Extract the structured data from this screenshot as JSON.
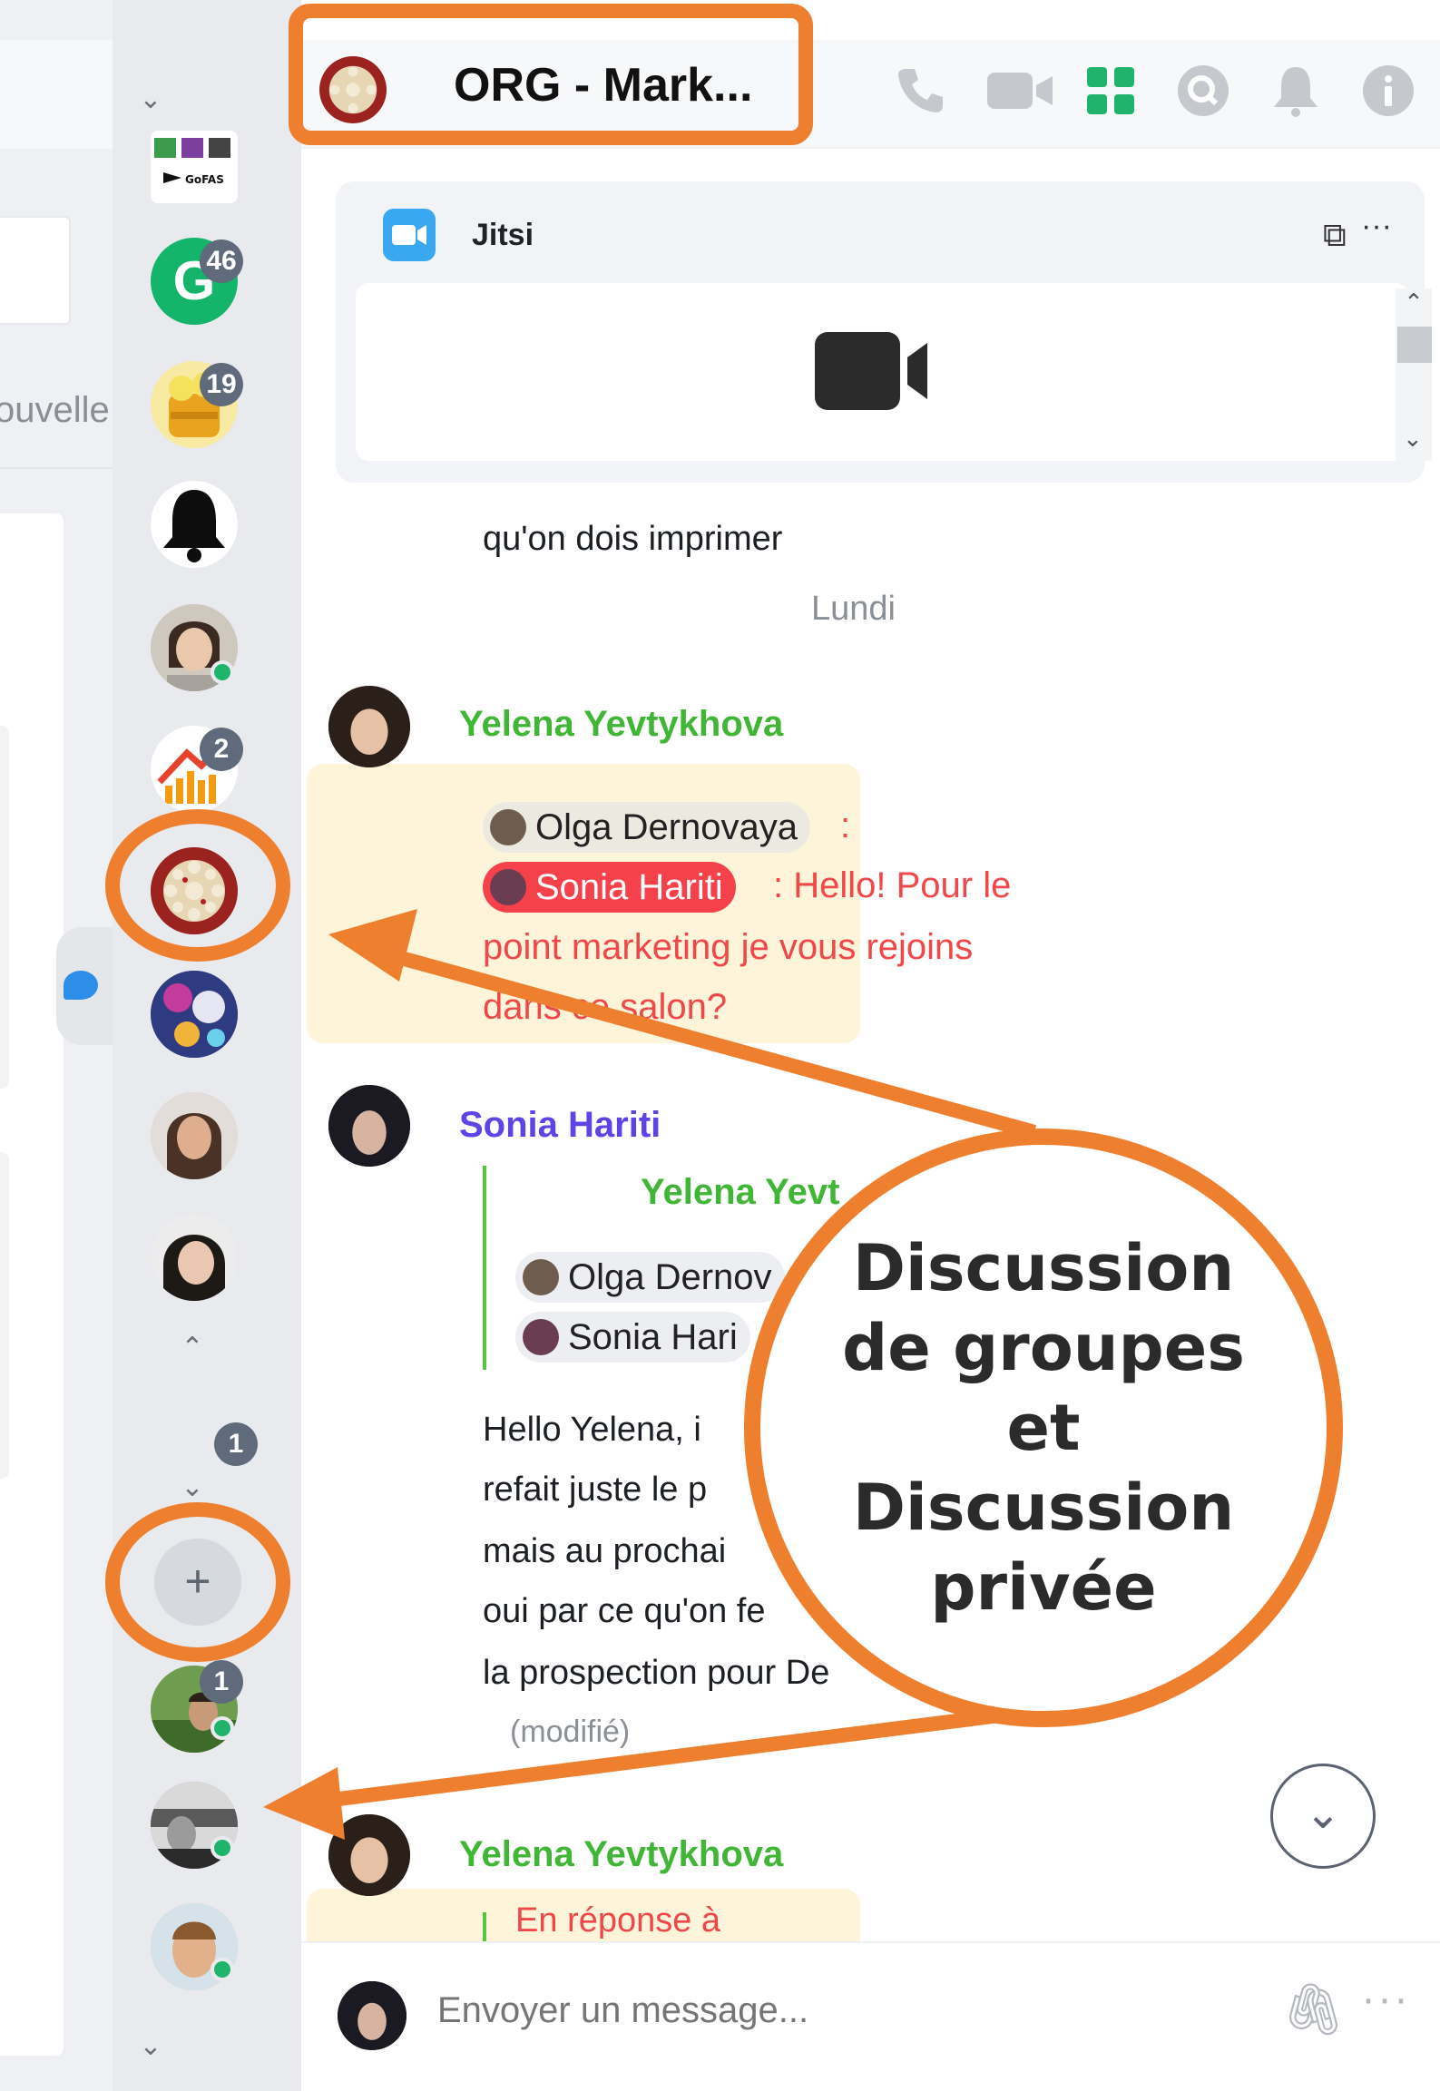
{
  "left_pane": {
    "partial_text": "ouvelle"
  },
  "header": {
    "title": "ORG - Mark..."
  },
  "jitsi": {
    "name": "Jitsi"
  },
  "messages": {
    "prev_line": "qu'on dois imprimer",
    "day_separator": "Lundi",
    "m1": {
      "author": "Yelena Yevtykhova",
      "mention1": "Olga Dernovaya",
      "colon": ":",
      "mention2": "Sonia Hariti",
      "line1": ": Hello! Pour le",
      "line2": "point marketing je vous rejoins",
      "line3": "dans ce salon?"
    },
    "m2": {
      "author": "Sonia Hariti",
      "quote_author": "Yelena Yevt",
      "quote_m1": "Olga Dernov",
      "quote_m2": "Sonia Hari",
      "lines": [
        "Hello Yelena, i",
        "refait juste le p",
        "mais au prochai",
        "oui par ce qu'on fe",
        "la prospection pour De"
      ],
      "modified": "(modifié)"
    },
    "m3": {
      "author": "Yelena Yevtykhova",
      "reply_text": "En réponse à"
    }
  },
  "composer": {
    "placeholder": "Envoyer un message..."
  },
  "sidebar": {
    "badges": {
      "g": "46",
      "honey": "19",
      "chart": "2",
      "group": "1",
      "user": "1"
    },
    "gofas_label": "GoFAS"
  },
  "callout": {
    "text": "Discussion\nde groupes\net\nDiscussion\nprivée"
  },
  "colors": {
    "accent_orange": "#ee7f2e",
    "online_green": "#1fb36b",
    "mention_red": "#f5424a",
    "author_green": "#41b636",
    "author_purple": "#5e43e6"
  }
}
